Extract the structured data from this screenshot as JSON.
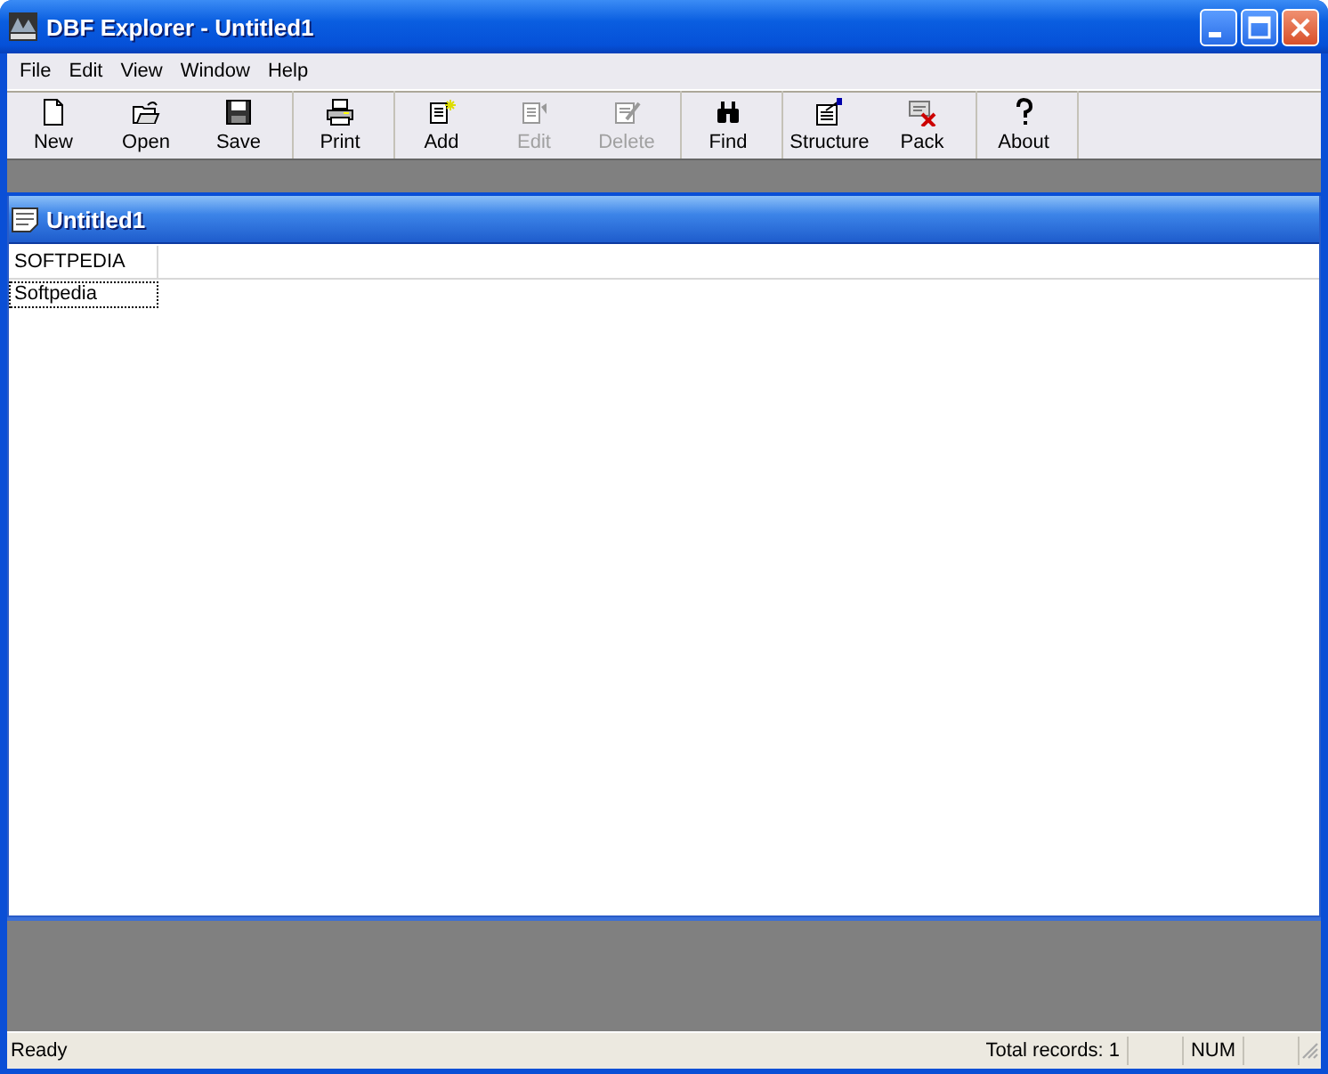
{
  "window": {
    "title": "DBF Explorer - Untitled1"
  },
  "menu": [
    "File",
    "Edit",
    "View",
    "Window",
    "Help"
  ],
  "toolbar": [
    {
      "buttons": [
        {
          "label": "New",
          "disabled": false
        },
        {
          "label": "Open",
          "disabled": false
        },
        {
          "label": "Save",
          "disabled": false
        }
      ]
    },
    {
      "buttons": [
        {
          "label": "Print",
          "disabled": false
        }
      ]
    },
    {
      "buttons": [
        {
          "label": "Add",
          "disabled": false
        },
        {
          "label": "Edit",
          "disabled": true
        },
        {
          "label": "Delete",
          "disabled": true
        }
      ]
    },
    {
      "buttons": [
        {
          "label": "Find",
          "disabled": false
        }
      ]
    },
    {
      "buttons": [
        {
          "label": "Structure",
          "disabled": false
        },
        {
          "label": "Pack",
          "disabled": false
        }
      ]
    },
    {
      "buttons": [
        {
          "label": "About",
          "disabled": false
        }
      ]
    }
  ],
  "document": {
    "title": "Untitled1",
    "table": {
      "columns": [
        "SOFTPEDIA"
      ],
      "rows": [
        {
          "cells": [
            {
              "text": "Softpedia",
              "focused": true
            }
          ]
        }
      ]
    }
  },
  "status_bar": {
    "message": "Ready",
    "records": "Total records: 1",
    "num_lock": "NUM"
  }
}
